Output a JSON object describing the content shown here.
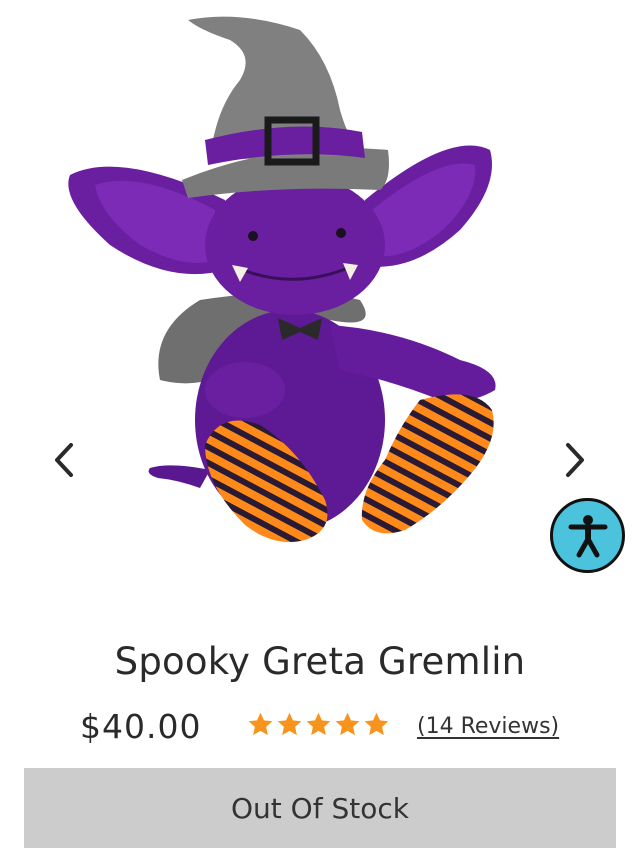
{
  "product": {
    "title": "Spooky Greta Gremlin",
    "price": "$40.00",
    "rating": 5,
    "rating_max": 5,
    "reviews_label": "(14 Reviews)",
    "stock_button_label": "Out Of Stock",
    "image": {
      "semantic": "purple-gremlin-plush-witch-hat-striped-socks"
    }
  },
  "gallery": {
    "prev_icon": "chevron-left-icon",
    "next_icon": "chevron-right-icon"
  },
  "accessibility": {
    "icon": "accessibility-person-icon"
  },
  "colors": {
    "star": "#f7941d",
    "accessibility_bg": "#4cc3dd",
    "button_bg": "#cccccc",
    "plush_purple": "#6a1fa0",
    "hat_grey": "#7a7a7a",
    "sock_orange": "#ff8a1a",
    "text": "#2a2a2a"
  }
}
